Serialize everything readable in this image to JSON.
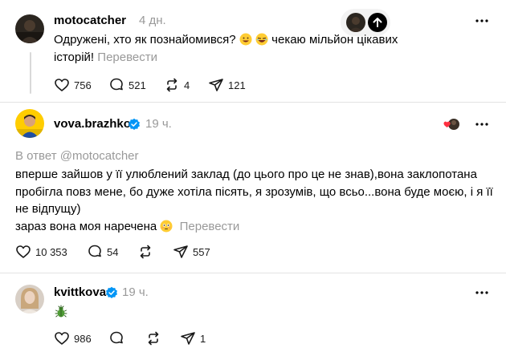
{
  "posts": [
    {
      "username": "motocatcher",
      "time": "4 дн.",
      "text_line1_a": "Одружені, хто як познайомився?",
      "text_line1_b": "чекаю мільйон цікавих",
      "text_line2": "історій!",
      "translate_label": "Перевести",
      "likes": "756",
      "replies": "521",
      "reposts": "4",
      "shares": "121"
    },
    {
      "username": "vova.brazhko",
      "time": "19 ч.",
      "reply_to": "В ответ @motocatcher",
      "text_line1": "вперше зайшов у її улюблений заклад (до цього про це не знав),вона заклопотана",
      "text_line2": "пробігла повз мене, бо дуже хотіла пісять, я зрозумів, що всьо...вона буде моєю, і я її",
      "text_line3": "не відпущу)",
      "text_line4": "зараз вона моя наречена",
      "translate_label": "Перевести",
      "likes": "10 353",
      "replies": "54",
      "reposts": "",
      "shares": "557"
    },
    {
      "username": "kvittkova",
      "time": "19 ч.",
      "likes": "986",
      "replies": "",
      "reposts": "",
      "shares": "1"
    }
  ],
  "colors": {
    "text": "#000000",
    "muted": "#999999",
    "verified": "#0095f6",
    "like_heart": "#ff3040",
    "divider": "#e3e3e3"
  },
  "icons": {
    "like": "heart-outline-icon",
    "reply": "comment-bubble-icon",
    "repost": "repost-arrows-icon",
    "share": "send-paper-plane-icon",
    "more": "more-dots-icon",
    "verified": "verified-badge-icon",
    "scroll_top": "arrow-up-icon"
  }
}
